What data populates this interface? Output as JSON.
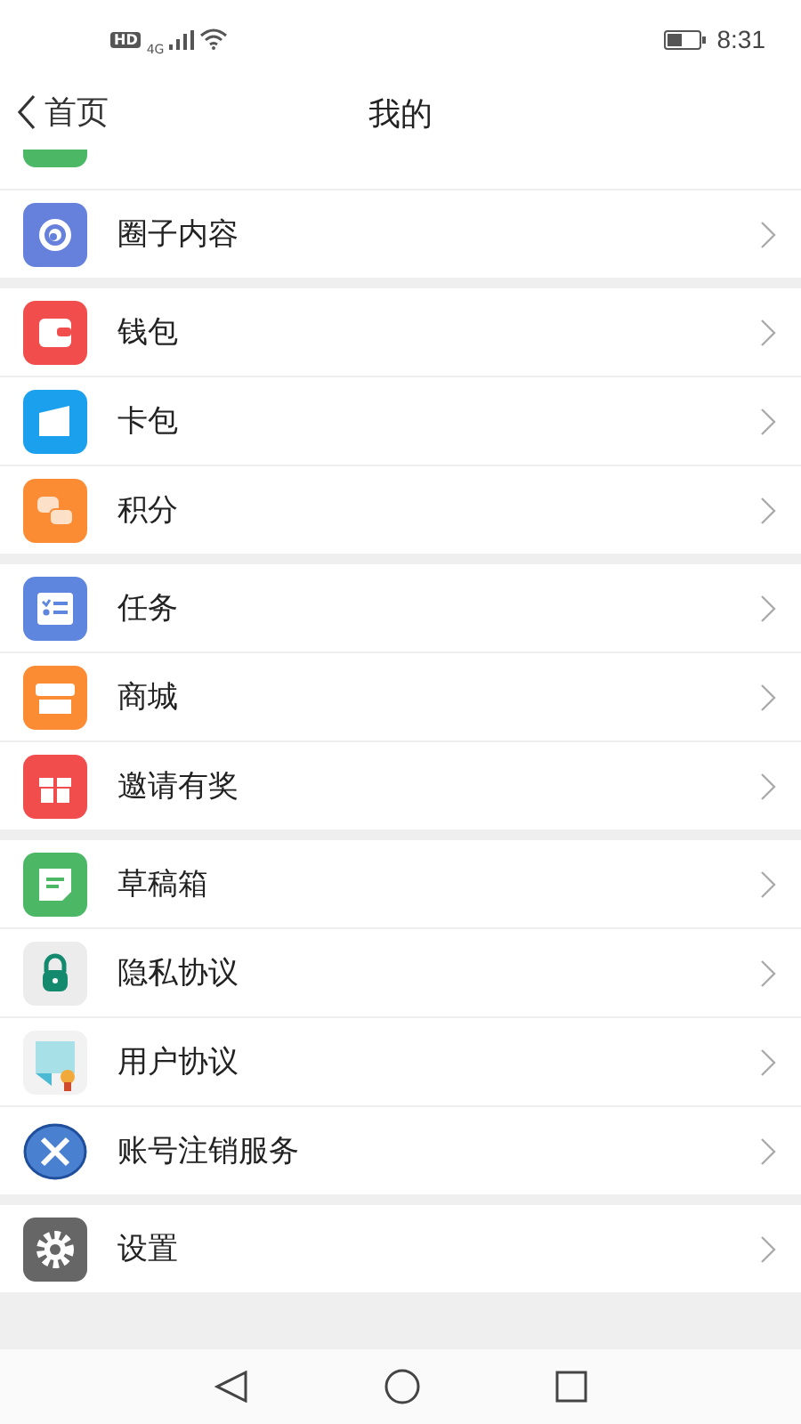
{
  "status_bar": {
    "hd": "HD",
    "network": "4G",
    "time": "8:31"
  },
  "header": {
    "back": "首页",
    "title": "我的"
  },
  "groups": [
    {
      "items": [
        {
          "kind": "cut"
        },
        {
          "kind": "row",
          "label": "圈子内容"
        }
      ]
    },
    {
      "items": [
        {
          "kind": "row",
          "label": "钱包"
        },
        {
          "kind": "row",
          "label": "卡包"
        },
        {
          "kind": "row",
          "label": "积分"
        }
      ]
    },
    {
      "items": [
        {
          "kind": "row",
          "label": "任务"
        },
        {
          "kind": "row",
          "label": "商城"
        },
        {
          "kind": "row",
          "label": "邀请有奖"
        }
      ]
    },
    {
      "items": [
        {
          "kind": "row",
          "label": "草稿箱"
        },
        {
          "kind": "row",
          "label": "隐私协议"
        },
        {
          "kind": "row",
          "label": "用户协议"
        },
        {
          "kind": "row",
          "label": "账号注销服务"
        }
      ]
    },
    {
      "items": [
        {
          "kind": "row",
          "label": "设置"
        }
      ]
    }
  ]
}
